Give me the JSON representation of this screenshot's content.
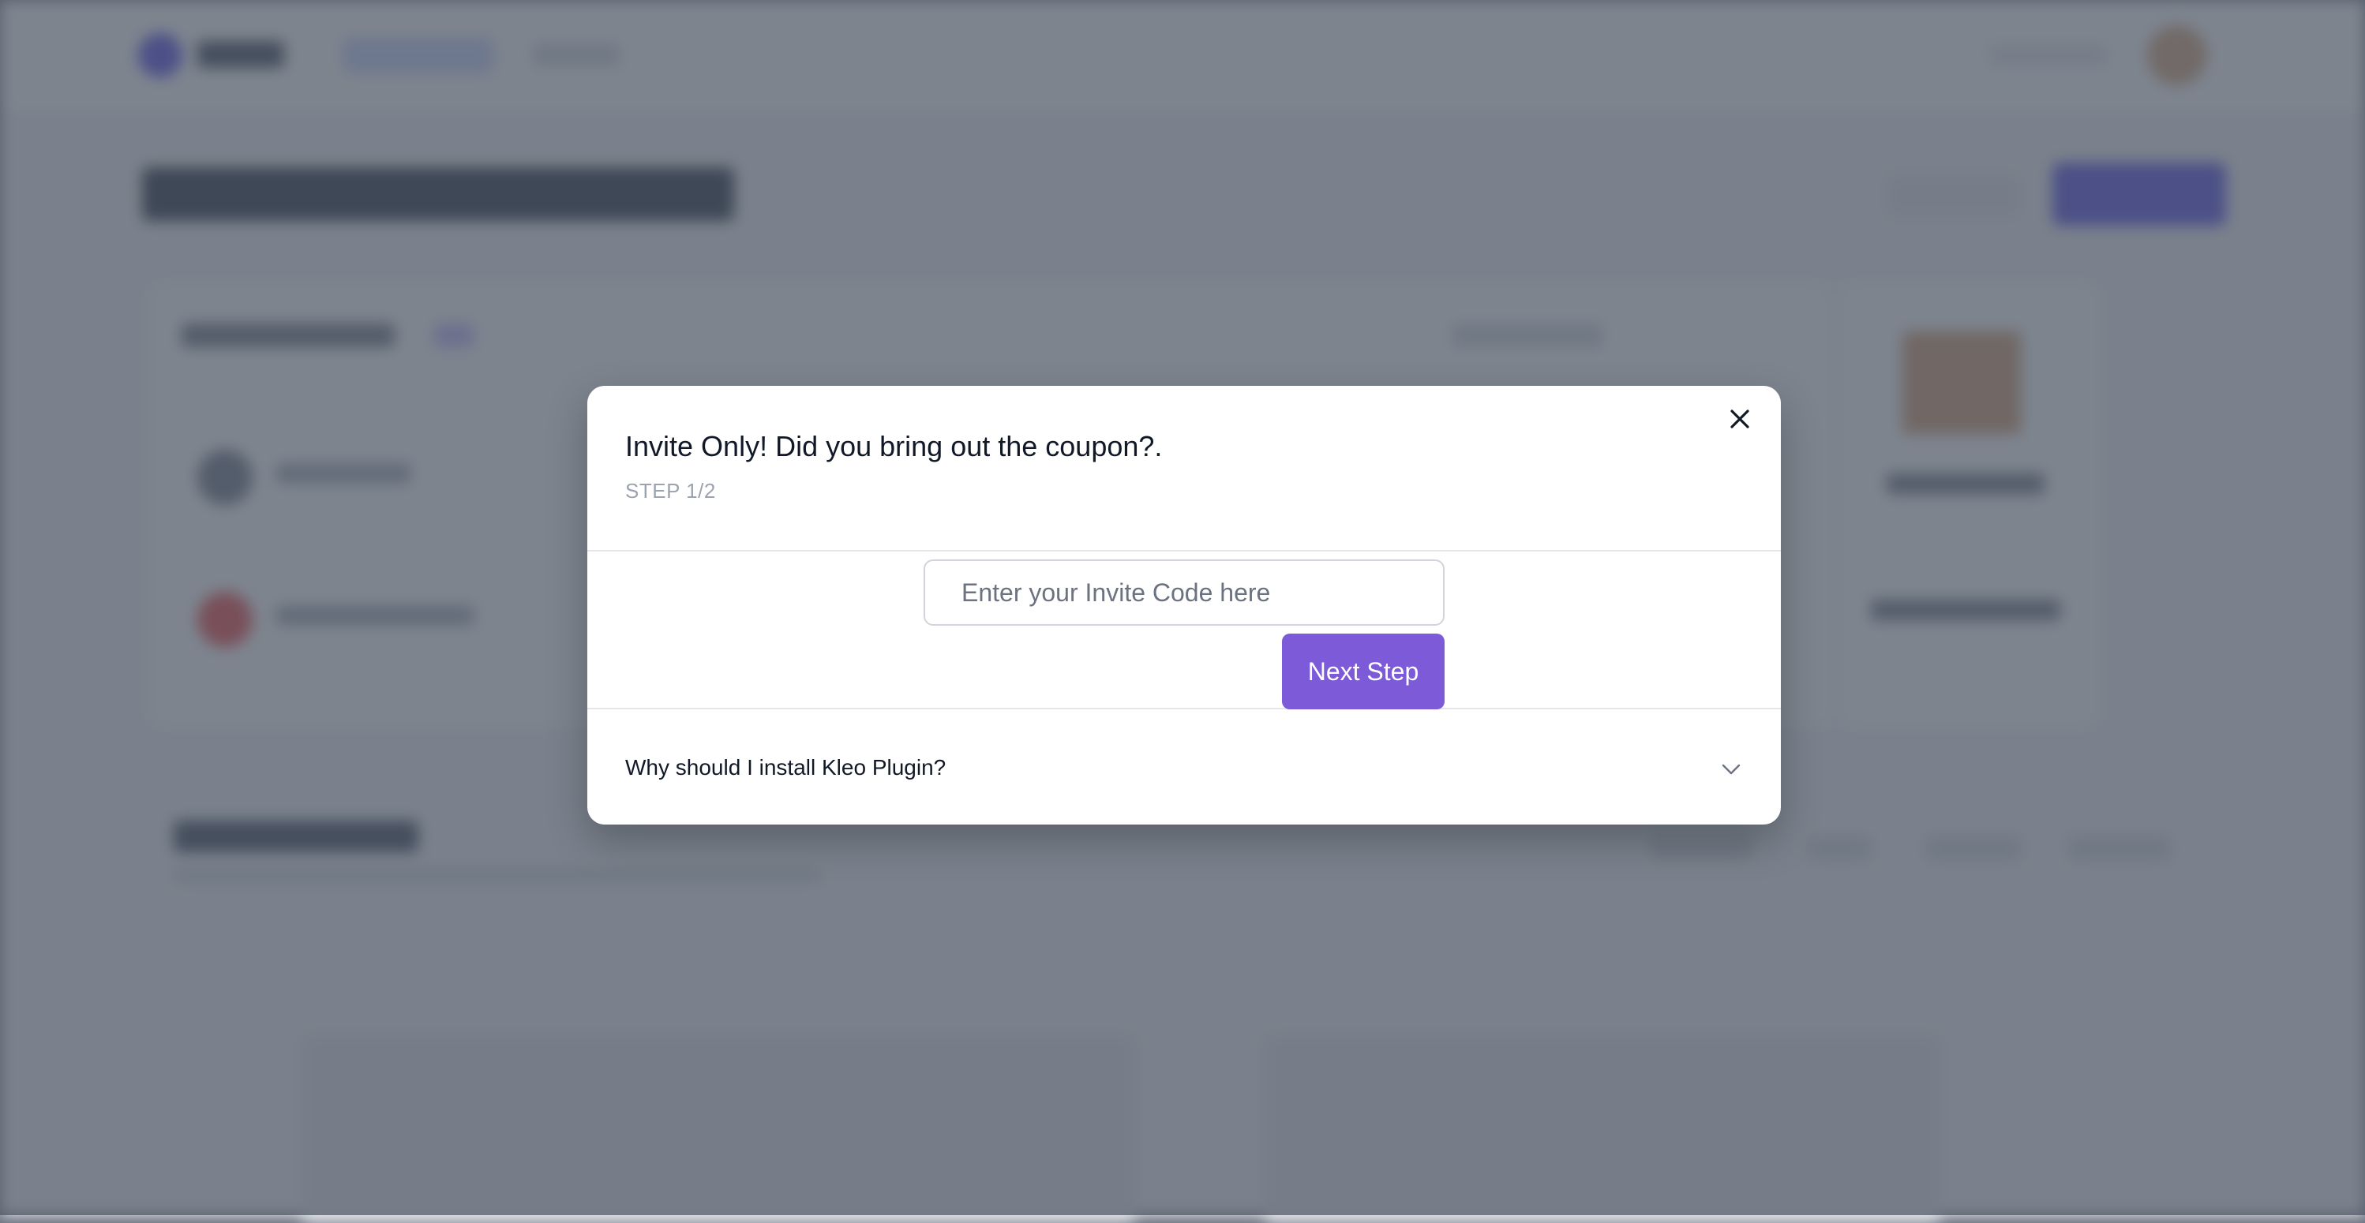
{
  "modal": {
    "title": "Invite Only! Did you bring out the coupon?.",
    "step": "STEP 1/2",
    "invite_placeholder": "Enter your Invite Code here",
    "invite_value": "",
    "next_button_label": "Next Step",
    "faq_question": "Why should I install Kleo Plugin?",
    "close_icon": "close-icon",
    "chevron_icon": "chevron-down-icon",
    "accent_color": "#7c5ad8"
  }
}
